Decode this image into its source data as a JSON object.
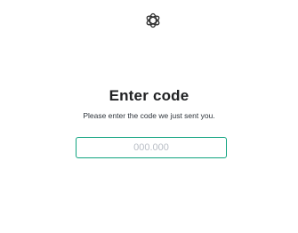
{
  "logo": {
    "icon": "openai-logo-icon"
  },
  "heading": {
    "title": "Enter code"
  },
  "subtitle": {
    "text": "Please enter the code we just sent you."
  },
  "code_field": {
    "placeholder": "000.000",
    "value": ""
  },
  "colors": {
    "accent": "#10a37f",
    "title": "#202123",
    "text": "#2d333a",
    "placeholder": "#b9bec6"
  }
}
